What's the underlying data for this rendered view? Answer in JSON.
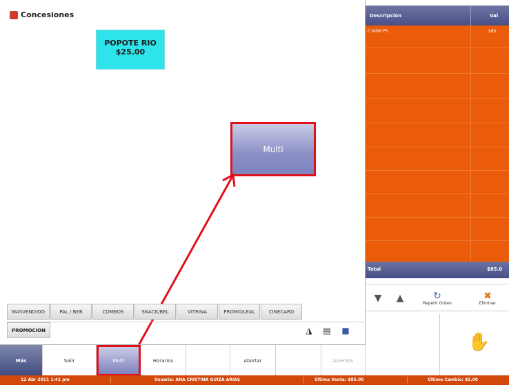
{
  "window": {
    "title": "Concesiones"
  },
  "product_tile": {
    "name": "POPOTE RIO",
    "price": "$25.00"
  },
  "multi_tile": {
    "label": "Multi"
  },
  "categories": [
    "MASVENDIDO",
    "PAL / BEB",
    "COMBOS",
    "SNACK/BEL",
    "VITRINA",
    "PROMO/LEAL",
    "CINECARD"
  ],
  "promo": {
    "label": "PROMOCION"
  },
  "toolbar_icons": [
    "glasses-icon",
    "film-icon",
    "cube-icon"
  ],
  "bottom_bar": {
    "mas": "Más",
    "salir": "Salir",
    "multi": "Multi",
    "horarios": "Horarios",
    "abortar": "Abortar",
    "asientos": "Asientos"
  },
  "order_grid": {
    "headers": [
      "Descripción",
      "Val"
    ],
    "rows": [
      {
        "description": "C MSM PS",
        "value": "$85."
      }
    ],
    "total_label": "Total",
    "total_value": "$85.0"
  },
  "actions": {
    "down": "▼",
    "up": "▲",
    "repeat": "Repetir Orden",
    "delete": "Eliminar"
  },
  "status_bar": {
    "date": "12 Abr 2011 1:41 pm",
    "user": "Usuario: ANA CRISTINA GUIZA ARIAS",
    "last_sale": "Última Venta: $85.00",
    "last_change": "Último Cambio: $5.00"
  },
  "colors": {
    "accent_orange": "#ea5c0a",
    "highlight_red": "#e0101a",
    "tile_cyan": "#2fe3ea",
    "header_blue": "#484f86"
  }
}
